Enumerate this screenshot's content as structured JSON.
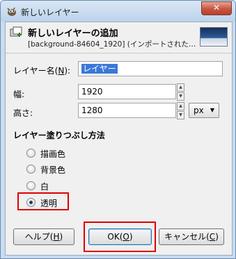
{
  "window": {
    "title": "新しいレイヤー",
    "close_label": "✕"
  },
  "header": {
    "title": "新しいレイヤーの追加",
    "subtitle": "[background-84604_1920] (インポートされた…"
  },
  "form": {
    "name_label": "レイヤー名(",
    "name_accel": "N",
    "name_label_end": "):",
    "name_value": "レイヤー",
    "width_label": "幅:",
    "width_value": "1920",
    "height_label": "高さ:",
    "height_value": "1280",
    "unit_value": "px"
  },
  "fill": {
    "title": "レイヤー塗りつぶし方法",
    "options": [
      {
        "label": "描画色",
        "checked": false
      },
      {
        "label": "背景色",
        "checked": false
      },
      {
        "label": "白",
        "checked": false
      },
      {
        "label": "透明",
        "checked": true
      }
    ]
  },
  "buttons": {
    "help": {
      "label": "ヘルプ(",
      "accel": "H",
      "end": ")"
    },
    "ok": {
      "label": "OK(",
      "accel": "O",
      "end": ")"
    },
    "cancel": {
      "label": "キャンセル(",
      "accel": "C",
      "end": ")"
    }
  },
  "icons": {
    "title_icon": "gimp-wilber-icon",
    "header_icon": "new-layer-icon",
    "close_icon": "close-icon",
    "unit_arrow": "chevron-down-icon"
  },
  "colors": {
    "highlight": "#e00000",
    "selection": "#3a78d8",
    "close": "#c9543f"
  }
}
